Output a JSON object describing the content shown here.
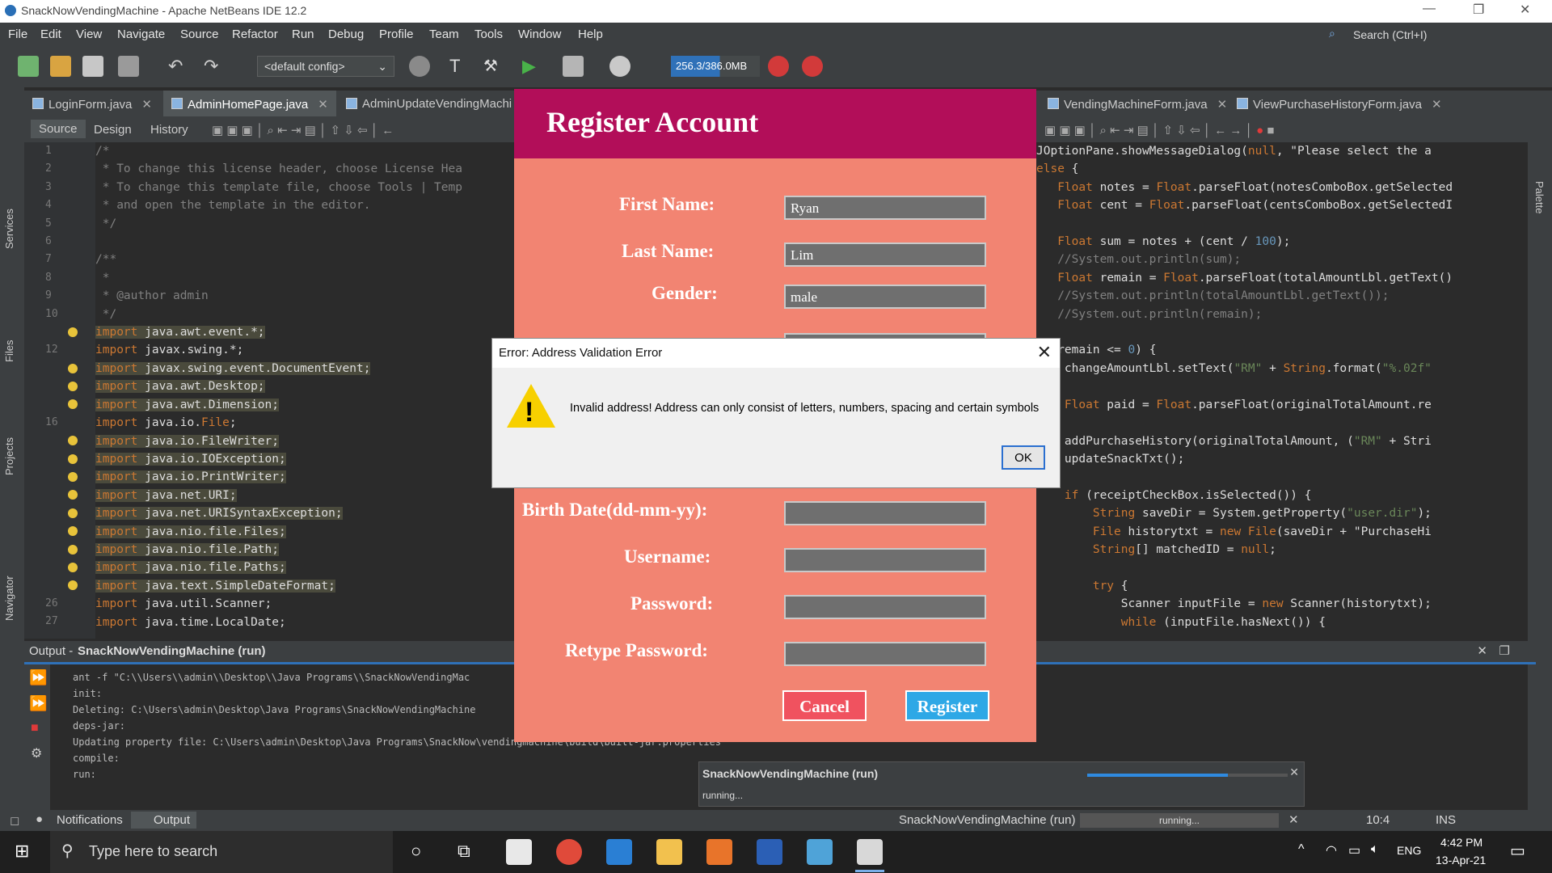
{
  "window": {
    "title": "SnackNowVendingMachine - Apache NetBeans IDE 12.2",
    "minimize": "—",
    "restore": "❐",
    "close": "✕"
  },
  "menu": [
    "File",
    "Edit",
    "View",
    "Navigate",
    "Source",
    "Refactor",
    "Run",
    "Debug",
    "Profile",
    "Team",
    "Tools",
    "Window",
    "Help"
  ],
  "search": {
    "placeholder": "Search (Ctrl+I)"
  },
  "toolbar": {
    "config": "<default config>",
    "memory": "256.3/386.0MB"
  },
  "tabs": [
    "LoginForm.java",
    "AdminHomePage.java",
    "AdminUpdateVendingMachi",
    "VendingMachineForm.java",
    "ViewPurchaseHistoryForm.java"
  ],
  "editor_modes": {
    "source": "Source",
    "design": "Design",
    "history": "History"
  },
  "side_labels": {
    "services": "Services",
    "files": "Files",
    "projects": "Projects",
    "navigator": "Navigator",
    "palette": "Palette"
  },
  "line_numbers": [
    "1",
    "2",
    "3",
    "4",
    "5",
    "6",
    "7",
    "8",
    "9",
    "10",
    "",
    "12",
    "",
    "",
    "",
    "16",
    "",
    "",
    "",
    "",
    "",
    "",
    "",
    "",
    "",
    "26",
    "27"
  ],
  "code_left": [
    "/*",
    " * To change this license header, choose License Hea",
    " * To change this template file, choose Tools | Temp",
    " * and open the template in the editor.",
    " */",
    "",
    "/**",
    " *",
    " * @author admin",
    " */",
    "import java.awt.event.*;",
    "import javax.swing.*;",
    "import javax.swing.event.DocumentEvent;",
    "import java.awt.Desktop;",
    "import java.awt.Dimension;",
    "import java.io.File;",
    "import java.io.FileWriter;",
    "import java.io.IOException;",
    "import java.io.PrintWriter;",
    "import java.net.URI;",
    "import java.net.URISyntaxException;",
    "import java.nio.file.Files;",
    "import java.nio.file.Path;",
    "import java.nio.file.Paths;",
    "import java.text.SimpleDateFormat;",
    "import java.util.Scanner;",
    "import java.time.LocalDate;"
  ],
  "code_right": [
    "JOptionPane.showMessageDialog(null, \"Please select the a",
    "else {",
    "   Float notes = Float.parseFloat(notesComboBox.getSelected",
    "   Float cent = Float.parseFloat(centsComboBox.getSelectedI",
    "",
    "   Float sum = notes + (cent / 100);",
    "   //System.out.println(sum);",
    "   Float remain = Float.parseFloat(totalAmountLbl.getText()",
    "   //System.out.println(totalAmountLbl.getText());",
    "   //System.out.println(remain);",
    "",
    "f (remain <= 0) {",
    "    changeAmountLbl.setText(\"RM\" + String.format(\"%.02f\"",
    "",
    "    Float paid = Float.parseFloat(originalTotalAmount.re",
    "",
    "    addPurchaseHistory(originalTotalAmount, (\"RM\" + Stri",
    "    updateSnackTxt();",
    "",
    "    if (receiptCheckBox.isSelected()) {",
    "        String saveDir = System.getProperty(\"user.dir\");",
    "        File historytxt = new File(saveDir + \"PurchaseHi",
    "        String[] matchedID = null;",
    "",
    "        try {",
    "            Scanner inputFile = new Scanner(historytxt);",
    "            while (inputFile.hasNext()) {"
  ],
  "output": {
    "title_prefix": "Output - ",
    "title": "SnackNowVendingMachine (run)",
    "lines": [
      "ant -f \"C:\\\\Users\\\\admin\\\\Desktop\\\\Java Programs\\\\SnackNowVendingMac",
      "init:",
      "Deleting: C:\\Users\\admin\\Desktop\\Java Programs\\SnackNowVendingMachine",
      "deps-jar:",
      "Updating property file: C:\\Users\\admin\\Desktop\\Java Programs\\SnackNow\\vendingmachine\\build\\built-jar.properties",
      "compile:",
      "run:"
    ]
  },
  "progress_popup": {
    "title": "SnackNowVendingMachine (run)",
    "status": "running...",
    "progress": 0.7
  },
  "statusbar": {
    "notifications": "Notifications",
    "output": "Output",
    "task": "SnackNowVendingMachine (run)",
    "running": "running...",
    "position": "10:4",
    "mode": "INS"
  },
  "register": {
    "title": "Register Account",
    "labels": {
      "first_name": "First Name:",
      "last_name": "Last Name:",
      "gender": "Gender:",
      "birth_date": "Birth Date(dd-mm-yy):",
      "username": "Username:",
      "password": "Password:",
      "retype": "Retype Password:"
    },
    "values": {
      "first_name": "Ryan",
      "last_name": "Lim",
      "gender": "male",
      "birth_date": "",
      "username": "",
      "password": "",
      "retype": ""
    },
    "cancel": "Cancel",
    "register": "Register",
    "colors": {
      "header": "#b20e59",
      "background": "#f28472",
      "cancel": "#f0525f",
      "register": "#2ea8e6"
    }
  },
  "dialog": {
    "title": "Error: Address Validation Error",
    "message": "Invalid address! Address can only consist of letters, numbers, spacing and certain symbols",
    "ok": "OK",
    "icon": "warning-icon"
  },
  "taskbar": {
    "search_placeholder": "Type here to search",
    "time": "4:42 PM",
    "date": "13-Apr-21",
    "lang": "ENG"
  }
}
